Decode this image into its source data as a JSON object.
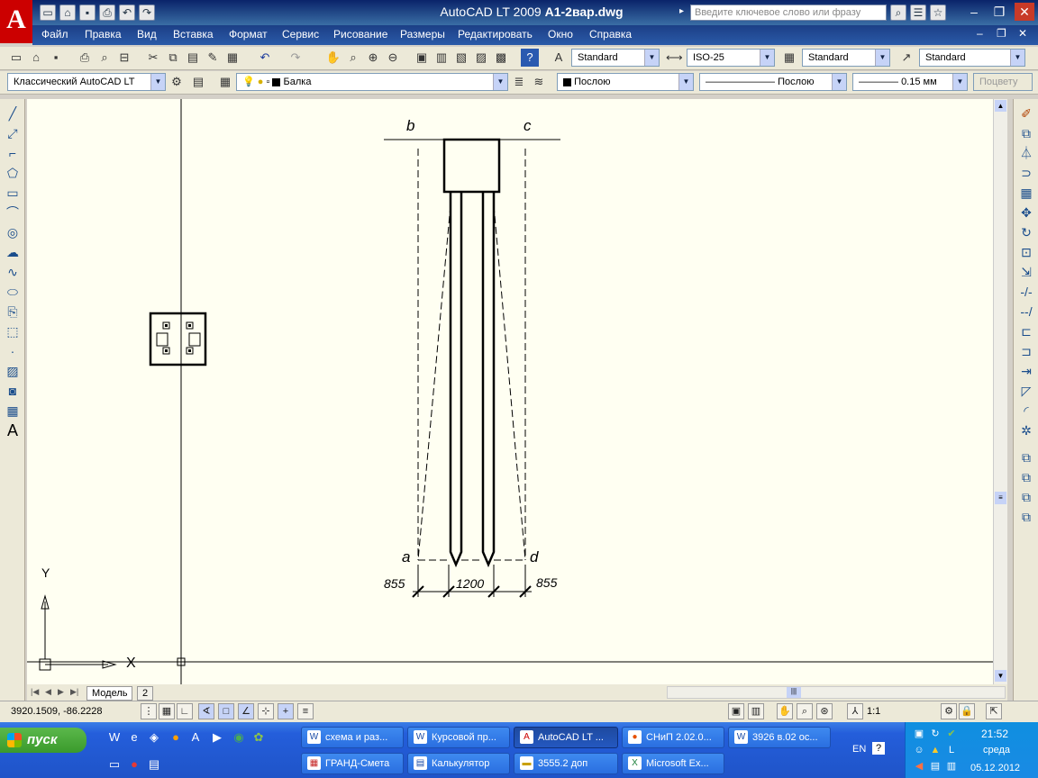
{
  "window": {
    "app_title": "AutoCAD LT 2009",
    "doc_title": "A1-2вар.dwg",
    "search_placeholder": "Введите ключевое слово или фразу",
    "logo": "A"
  },
  "menu": [
    "Файл",
    "Правка",
    "Вид",
    "Вставка",
    "Формат",
    "Сервис",
    "Рисование",
    "Размеры",
    "Редактировать",
    "Окно",
    "Справка"
  ],
  "styles": {
    "text_style": "Standard",
    "dim_style": "ISO-25",
    "table_style": "Standard",
    "mleader_style": "Standard"
  },
  "workspace": "Классический AutoCAD LT",
  "layer": {
    "name": "Балка",
    "color": "#000000"
  },
  "properties": {
    "color": "Послою",
    "linetype": "Послою",
    "lineweight": "0.15 мм",
    "plotstyle": "Поцвету"
  },
  "drawing": {
    "labels": {
      "b": "b",
      "c": "c",
      "a": "a",
      "d": "d"
    },
    "dims": {
      "left": "855",
      "middle": "1200",
      "right": "855"
    },
    "ucs_y": "Y",
    "ucs_x": "X"
  },
  "layout_tabs": [
    "Модель",
    "2"
  ],
  "status": {
    "coords": "3920.1509, -86.2228",
    "scale": "1:1"
  },
  "taskbar": {
    "start": "пуск",
    "tasks_row1": [
      "схема и раз...",
      "Курсовой пр...",
      "AutoCAD LT ...",
      "СНиП 2.02.0...",
      "3926 в.02 ос..."
    ],
    "tasks_row2": [
      "ГРАНД-Смета",
      "Калькулятор",
      "3555.2   доп",
      "Microsoft Ex..."
    ],
    "lang": "EN",
    "time": "21:52",
    "day": "среда",
    "date": "05.12.2012"
  }
}
